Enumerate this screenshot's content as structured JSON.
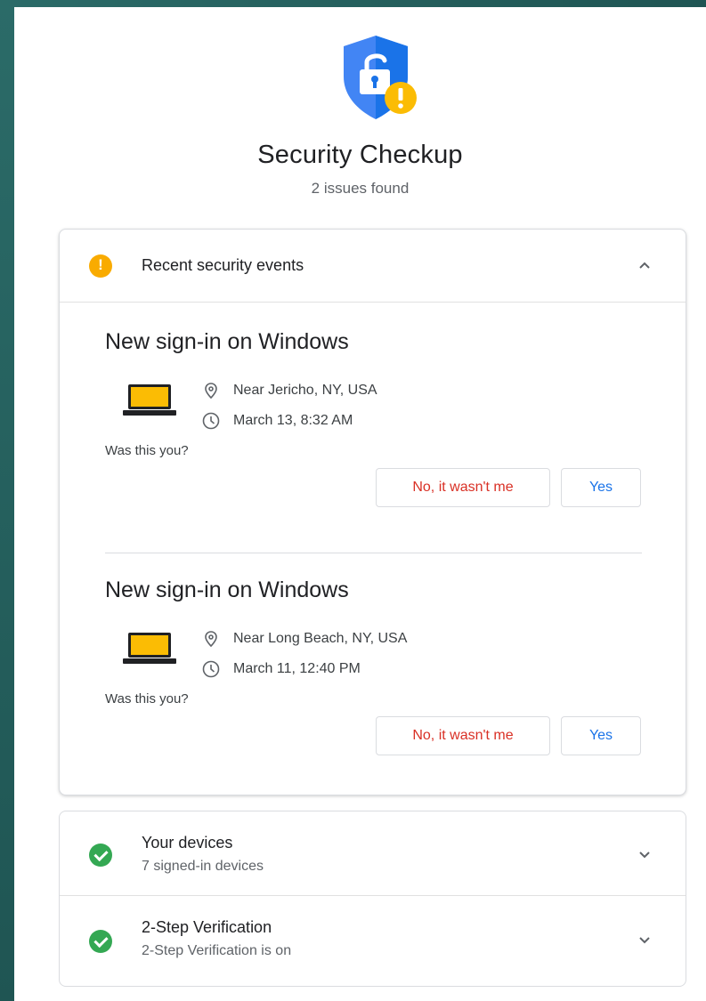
{
  "header": {
    "title": "Security Checkup",
    "subtitle": "2 issues found",
    "icon": "shield-lock-warning-icon"
  },
  "events_card": {
    "title": "Recent security events",
    "expanded": true,
    "events": [
      {
        "title": "New sign-in on Windows",
        "location": "Near Jericho, NY, USA",
        "time": "March 13, 8:32 AM",
        "question": "Was this you?",
        "no_label": "No, it wasn't me",
        "yes_label": "Yes"
      },
      {
        "title": "New sign-in on Windows",
        "location": "Near Long Beach, NY, USA",
        "time": "March 11, 12:40 PM",
        "question": "Was this you?",
        "no_label": "No, it wasn't me",
        "yes_label": "Yes"
      }
    ]
  },
  "sections": [
    {
      "title": "Your devices",
      "subtitle": "7 signed-in devices",
      "status": "ok"
    },
    {
      "title": "2-Step Verification",
      "subtitle": "2-Step Verification is on",
      "status": "ok"
    }
  ],
  "colors": {
    "warning": "#f9ab00",
    "success": "#34a853",
    "danger": "#d93025",
    "link": "#1a73e8",
    "shield": "#1a73e8",
    "frame": "#2b6b68"
  }
}
